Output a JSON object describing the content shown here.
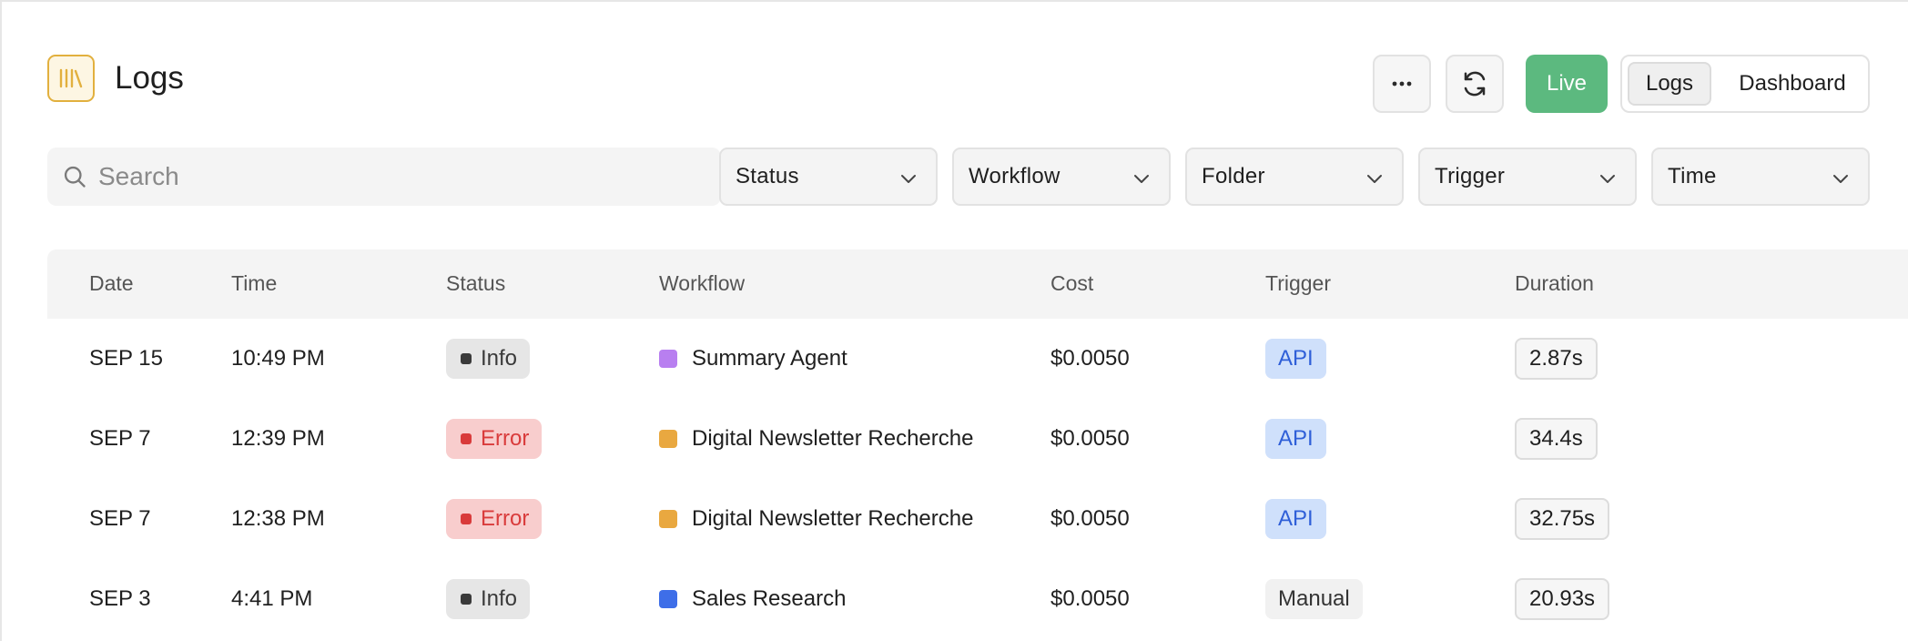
{
  "header": {
    "title": "Logs",
    "logo_icon": "library-icon",
    "more_icon": "ellipsis-icon",
    "refresh_icon": "refresh-icon",
    "live_label": "Live",
    "live_color": "#5cb97f",
    "view_toggle": {
      "logs_label": "Logs",
      "dashboard_label": "Dashboard",
      "selected": "Logs"
    }
  },
  "filters": {
    "search_placeholder": "Search",
    "search_value": "",
    "dropdowns": [
      {
        "label": "Status"
      },
      {
        "label": "Workflow"
      },
      {
        "label": "Folder"
      },
      {
        "label": "Trigger"
      },
      {
        "label": "Time"
      }
    ]
  },
  "table": {
    "columns": [
      "Date",
      "Time",
      "Status",
      "Workflow",
      "Cost",
      "Trigger",
      "Duration"
    ],
    "rows": [
      {
        "date": "SEP 15",
        "time": "10:49 PM",
        "status": "Info",
        "status_kind": "info",
        "workflow": "Summary Agent",
        "workflow_color": "#b87ff0",
        "cost": "$0.0050",
        "trigger": "API",
        "trigger_kind": "api",
        "duration": "2.87s"
      },
      {
        "date": "SEP 7",
        "time": "12:39 PM",
        "status": "Error",
        "status_kind": "error",
        "workflow": "Digital Newsletter Recherche",
        "workflow_color": "#e9a840",
        "cost": "$0.0050",
        "trigger": "API",
        "trigger_kind": "api",
        "duration": "34.4s"
      },
      {
        "date": "SEP 7",
        "time": "12:38 PM",
        "status": "Error",
        "status_kind": "error",
        "workflow": "Digital Newsletter Recherche",
        "workflow_color": "#e9a840",
        "cost": "$0.0050",
        "trigger": "API",
        "trigger_kind": "api",
        "duration": "32.75s"
      },
      {
        "date": "SEP 3",
        "time": "4:41 PM",
        "status": "Info",
        "status_kind": "info",
        "workflow": "Sales Research",
        "workflow_color": "#3e6ee8",
        "cost": "$0.0050",
        "trigger": "Manual",
        "trigger_kind": "manual",
        "duration": "20.93s"
      }
    ]
  }
}
